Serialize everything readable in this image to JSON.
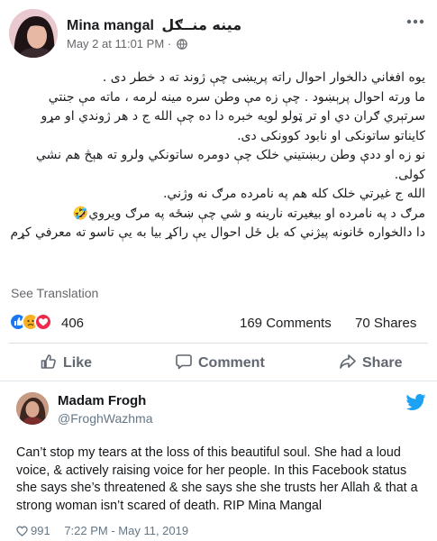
{
  "facebook_post": {
    "author": {
      "name": "Mina mangal",
      "name_native": "مینه منــګل"
    },
    "timestamp": "May 2 at 11:01 PM",
    "privacy_separator": "·",
    "privacy_icon": "globe-icon",
    "more_icon": "more-options-icon",
    "body_paragraphs": [
      "یوه افغاني دالخوار احوال راته پریښی چې ژوند ته د خطر دی .",
      "ما ورته احوال پرېښود . چې زه مې وطن سره مینه لرمه ، ماته مې جنتي سرتېري ګران دي او تر ټولو لویه خبره دا ده چې الله ج د هر ژوندي او مړو کایناتو ساتونکی او نابود کوونکی دی.",
      "نو زه او ددې وطن ربښتیني خلک چې دومره ساتونکي ولرو ته هېڅ هم نشي کولی.",
      "الله ج غیرتي خلک کله هم په نامرده مرګ نه وژني.",
      "مرګ د په نامرده او بیغیرته نارینه و شي چې ښځه په مرګ ویروي🤣",
      "دا دالخواره ځانونه پیژني که بل ځل احوال یې راکړ بیا به یې تاسو ته معرفي کړم"
    ],
    "see_translation": "See Translation",
    "reactions": {
      "icons": [
        "like-reaction-icon",
        "sad-reaction-icon",
        "love-reaction-icon"
      ],
      "count": "406"
    },
    "comments_count": "169 Comments",
    "shares_count": "70 Shares",
    "actions": {
      "like": "Like",
      "comment": "Comment",
      "share": "Share"
    },
    "colors": {
      "like_blue": "#1877f2",
      "sad_yellow": "#f7b125",
      "love_red": "#f02849",
      "meta_gray": "#65676b"
    }
  },
  "tweet": {
    "author_name": "Madam Frogh",
    "handle": "@FroghWazhma",
    "platform_icon": "twitter-bird-icon",
    "text": "Can’t stop my tears at the loss of this beautiful soul. She had a loud voice, & actively raising voice for her people. In this Facebook status she says she’s threatened & she says she she trusts her Allah & that a strong woman isn’t scared of death. RIP Mina Mangal",
    "likes": "991",
    "timestamp": "7:22 PM - May 11, 2019",
    "colors": {
      "twitter_blue": "#1da1f2",
      "secondary_gray": "#657786"
    }
  }
}
